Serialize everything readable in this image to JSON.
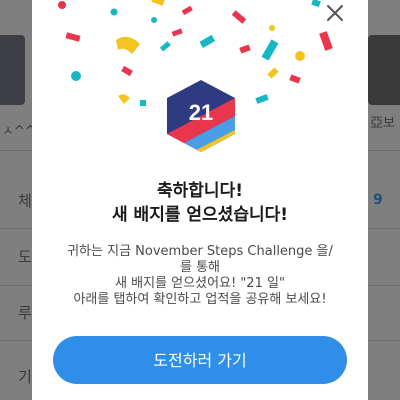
{
  "background": {
    "left_label": "ㅅ^^",
    "right_label": "亞보",
    "side_labels": [
      "체",
      "도",
      "루",
      "기"
    ],
    "badge_number_right": "9"
  },
  "dialog": {
    "close_icon": "close-icon",
    "badge_number": "21",
    "title_line1": "축하합니다!",
    "title_line2": "새 배지를 얻으셨습니다!",
    "message_line1": "귀하는 지금  November Steps Challenge 을/",
    "message_line2": "를 통해",
    "message_line3": "새 배지를 얻으셨어요!  \"21 일\"",
    "message_line4": "아래를 탭하여 확인하고 업적을 공유해 보세요!",
    "cta_label": "도전하러 가기"
  },
  "colors": {
    "accent": "#2f8ee8",
    "badge_navy": "#2e3b80",
    "badge_red": "#e8364c",
    "badge_blue": "#4a9ee8",
    "badge_yellow": "#f4c421"
  }
}
